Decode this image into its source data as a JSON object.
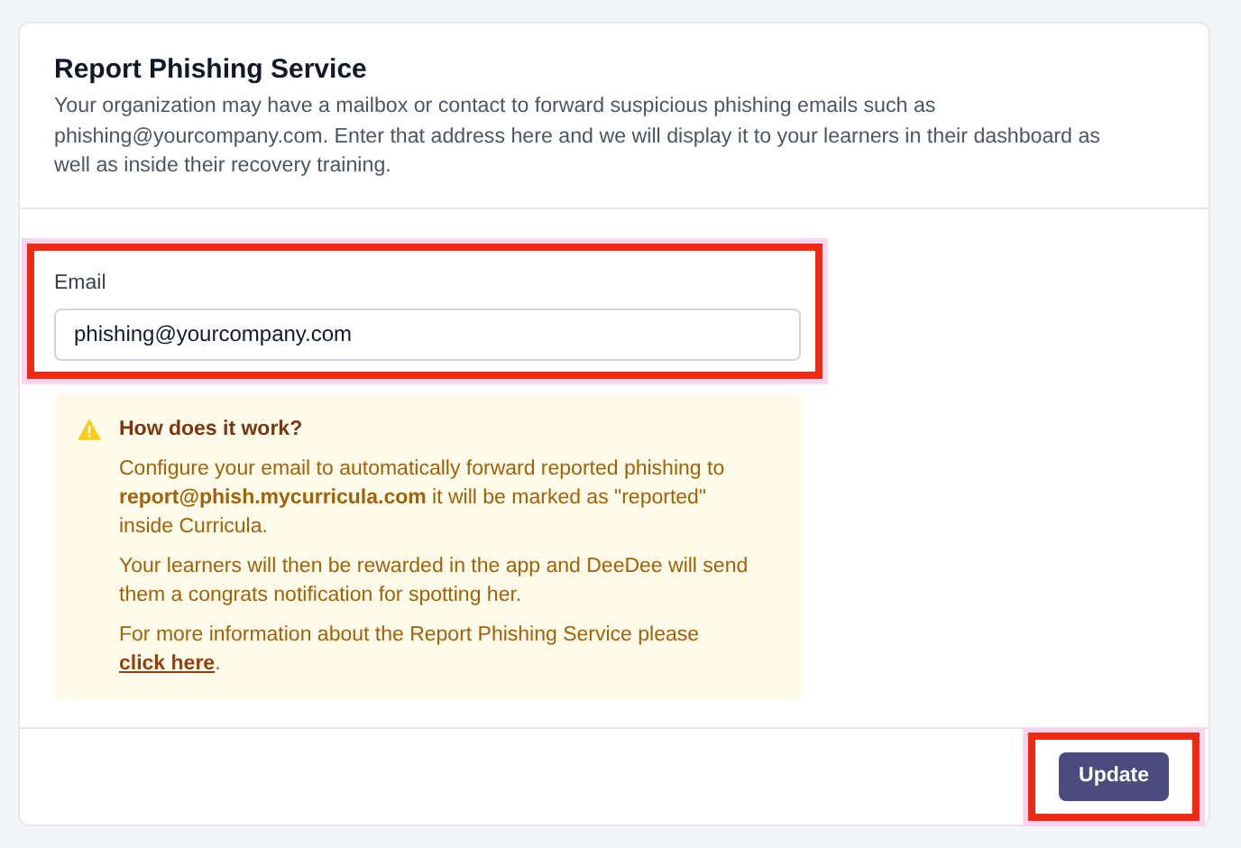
{
  "card": {
    "title": "Report Phishing Service",
    "description": "Your organization may have a mailbox or contact to forward suspicious phishing emails such as phishing@yourcompany.com. Enter that address here and we will display it to your learners in their dashboard as well as inside their recovery training."
  },
  "email_field": {
    "label": "Email",
    "value": "phishing@yourcompany.com"
  },
  "notice": {
    "title": "How does it work?",
    "paragraphs": [
      {
        "text": "Configure your email to automatically forward reported phishing to **report@phish.mycurricula.com** it will be marked as \"reported\" inside Curricula."
      },
      {
        "text": "Your learners will then be rewarded in the app and DeeDee will send them a congrats notification for spotting her."
      },
      {
        "text": "For more information about the Report Phishing Service please",
        "link": "click here",
        "after": "."
      }
    ]
  },
  "buttons": [
    {
      "label": "Update"
    }
  ]
}
